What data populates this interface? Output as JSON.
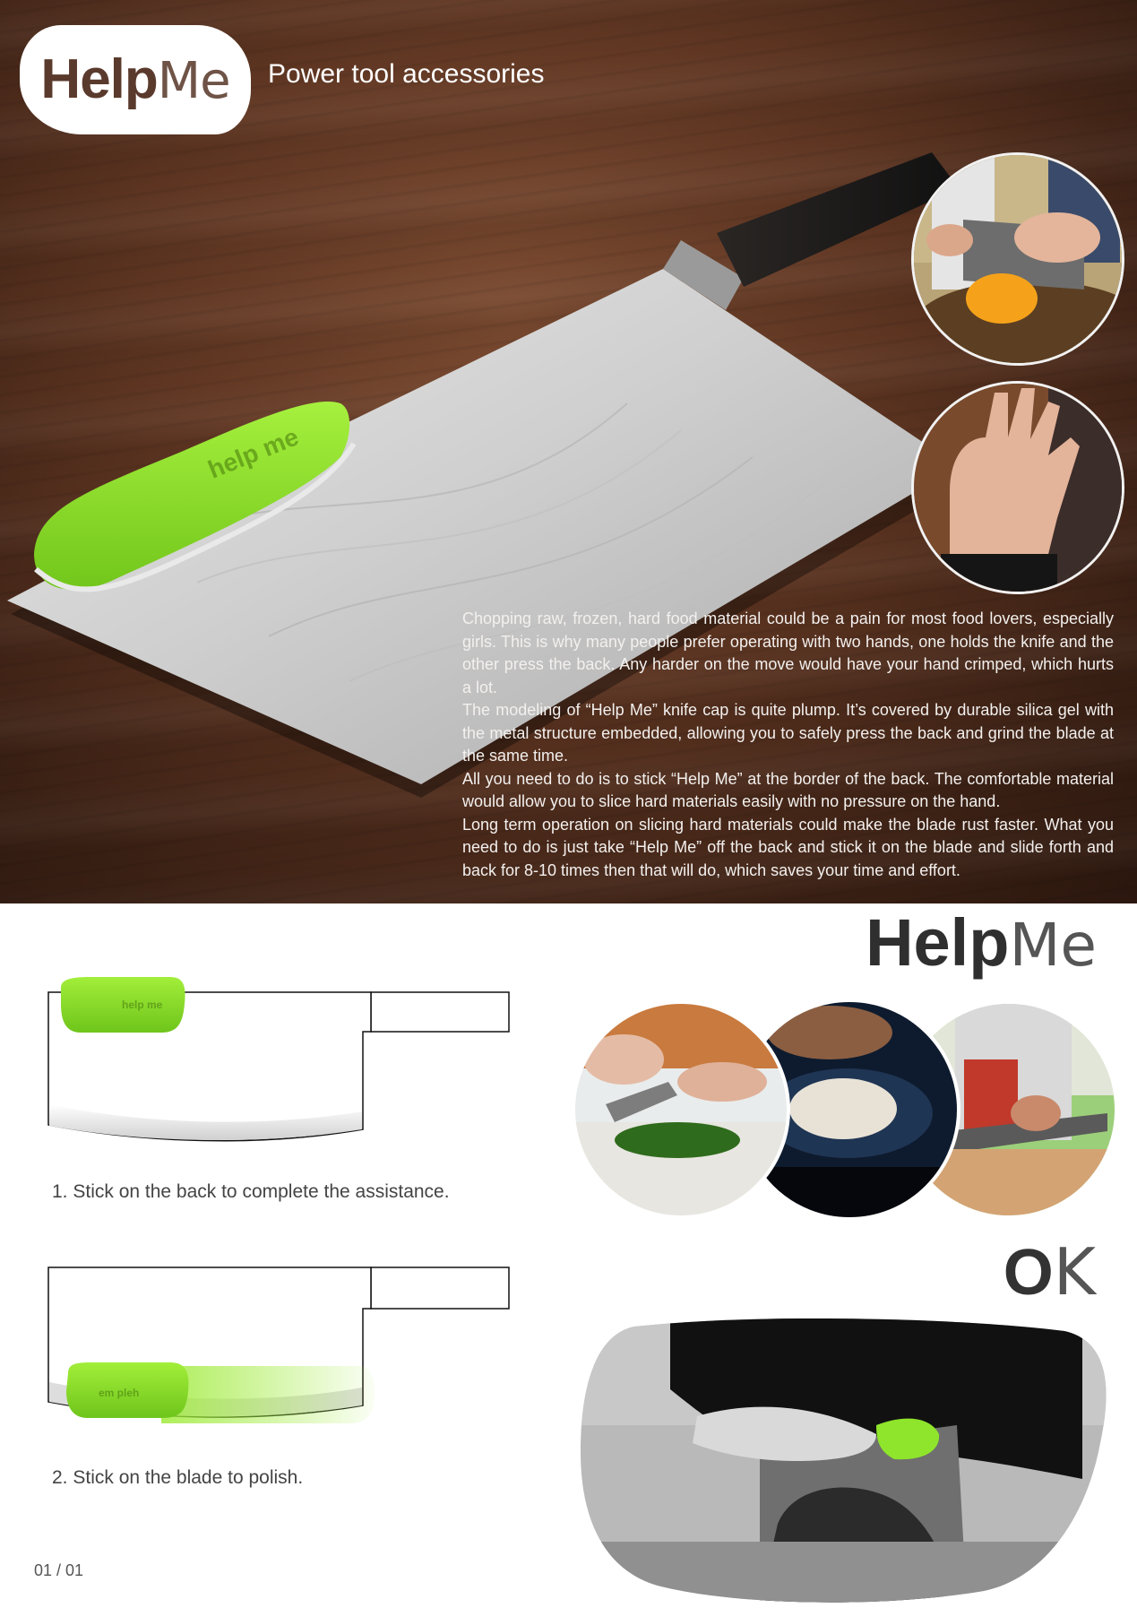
{
  "header": {
    "logo_bold": "Help",
    "logo_thin": "Me",
    "tagline": "Power tool accessories"
  },
  "product": {
    "cap_label": "help me",
    "accent_color": "#8ee52b"
  },
  "description": {
    "paragraphs": [
      "Chopping raw, frozen, hard food material could be a pain for most food lovers, especially girls. This is why many people prefer operating with two hands, one holds the knife and the other press the back. Any harder on the move would have your hand crimped, which hurts a lot.",
      "The modeling of “Help Me” knife cap is quite plump. It’s covered by durable silica gel with the metal structure embedded, allowing you to safely press the back and grind the blade at the same time.",
      "All you need to do is to stick “Help Me” at the border of the back. The comfortable material would allow you to slice hard materials easily with no pressure on the hand.",
      "Long term operation on slicing hard materials could make the blade rust faster. What you need to do is just take “Help Me” off the back and stick it on the blade and slide forth and back for 8-10 times then that will do, which saves your time and effort."
    ]
  },
  "brand_bottom": {
    "bold": "Help",
    "thin": "Me"
  },
  "ok_word": {
    "bold": "O",
    "thin": "K"
  },
  "steps": [
    {
      "label": "1.  Stick on the back to complete the assistance."
    },
    {
      "label": "2.  Stick on the blade to polish."
    }
  ],
  "page_number": "01 / 01"
}
